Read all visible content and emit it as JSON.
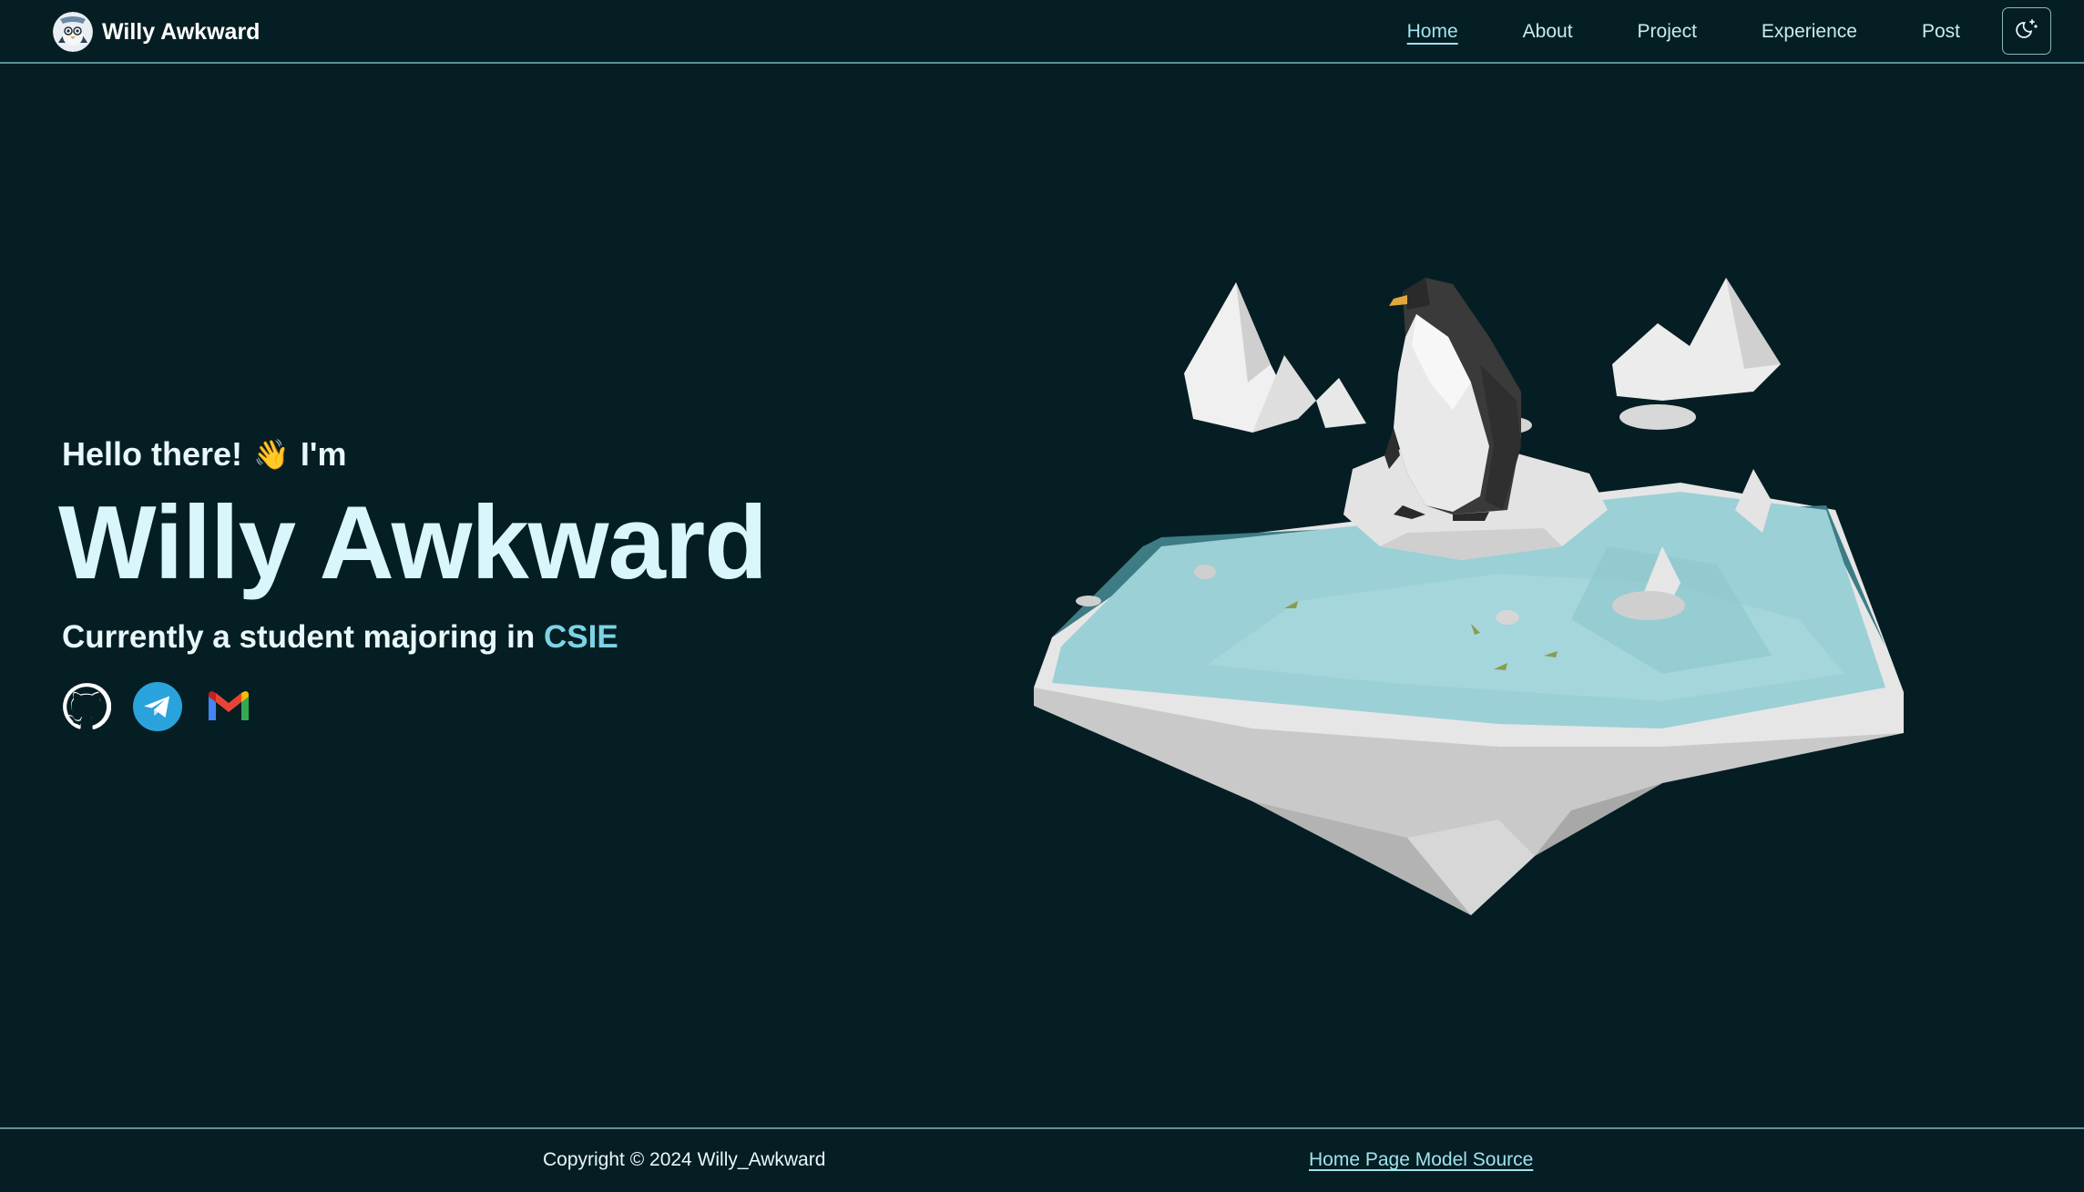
{
  "header": {
    "brand_name": "Willy Awkward",
    "avatar_icon": "penguin-avatar-icon",
    "nav": [
      {
        "label": "Home",
        "active": true
      },
      {
        "label": "About",
        "active": false
      },
      {
        "label": "Project",
        "active": false
      },
      {
        "label": "Experience",
        "active": false
      },
      {
        "label": "Post",
        "active": false
      }
    ],
    "theme_toggle_icon": "moon-stars-icon"
  },
  "hero": {
    "greeting_prefix": "Hello there!",
    "wave_emoji": "👋",
    "greeting_suffix": "I'm",
    "name": "Willy Awkward",
    "tagline_prefix": "Currently a student majoring in",
    "major": "CSIE",
    "socials": [
      {
        "icon": "github-icon"
      },
      {
        "icon": "telegram-icon"
      },
      {
        "icon": "gmail-icon"
      }
    ]
  },
  "model": {
    "icon": "penguin-iceberg-illustration"
  },
  "footer": {
    "copyright": "Copyright © 2024 Willy_Awkward",
    "model_source_link": "Home Page Model Source"
  },
  "colors": {
    "background": "#051e23",
    "accent": "#7dd3e6",
    "divider": "#5e8f97"
  }
}
